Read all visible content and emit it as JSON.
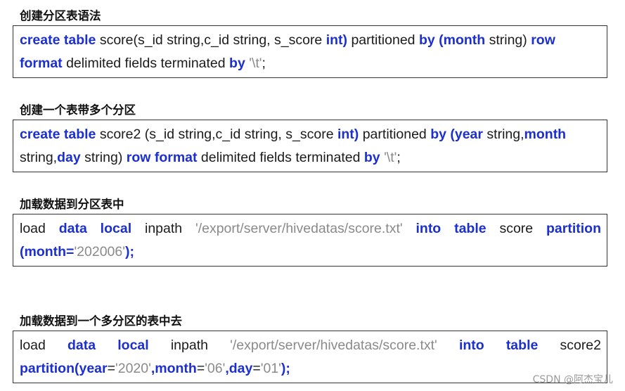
{
  "sections": [
    {
      "heading": "创建分区表语法",
      "lines": [
        [
          {
            "t": "create table",
            "k": "kw"
          },
          {
            "t": " score(s_id string,c_id string, s_score ",
            "k": "p"
          },
          {
            "t": "int)",
            "k": "kw"
          },
          {
            "t": " partitioned ",
            "k": "p"
          },
          {
            "t": "by (month",
            "k": "kw"
          },
          {
            "t": " string) ",
            "k": "p"
          },
          {
            "t": "row",
            "k": "kw"
          }
        ],
        [
          {
            "t": "format",
            "k": "kw"
          },
          {
            "t": " delimited fields terminated ",
            "k": "p"
          },
          {
            "t": "by",
            "k": "kw"
          },
          {
            "t": " ",
            "k": "p"
          },
          {
            "t": "'\\t'",
            "k": "str"
          },
          {
            "t": ";",
            "k": "p"
          }
        ]
      ]
    },
    {
      "heading": "创建一个表带多个分区",
      "lines": [
        [
          {
            "t": "create table",
            "k": "kw"
          },
          {
            "t": " score2 (s_id string,c_id string, s_score ",
            "k": "p"
          },
          {
            "t": "int)",
            "k": "kw"
          },
          {
            "t": " partitioned ",
            "k": "p"
          },
          {
            "t": "by (year",
            "k": "kw"
          },
          {
            "t": " string,",
            "k": "p"
          },
          {
            "t": "month",
            "k": "kw"
          }
        ],
        [
          {
            "t": "string,",
            "k": "p"
          },
          {
            "t": "day",
            "k": "kw"
          },
          {
            "t": " string) ",
            "k": "p"
          },
          {
            "t": "row format",
            "k": "kw"
          },
          {
            "t": " delimited fields terminated ",
            "k": "p"
          },
          {
            "t": "by",
            "k": "kw"
          },
          {
            "t": " ",
            "k": "p"
          },
          {
            "t": "'\\t'",
            "k": "str"
          },
          {
            "t": ";",
            "k": "p"
          }
        ]
      ]
    },
    {
      "heading": "加载数据到分区表中",
      "lines": [
        [
          {
            "t": "load ",
            "k": "p"
          },
          {
            "t": "data local",
            "k": "kw"
          },
          {
            "t": " inpath ",
            "k": "p"
          },
          {
            "t": "'/export/server/hivedatas/score.txt'",
            "k": "str"
          },
          {
            "t": " ",
            "k": "p"
          },
          {
            "t": "into table",
            "k": "kw"
          },
          {
            "t": " score ",
            "k": "p"
          },
          {
            "t": "partition",
            "k": "kw"
          }
        ],
        [
          {
            "t": "(month=",
            "k": "kw"
          },
          {
            "t": "'202006'",
            "k": "str"
          },
          {
            "t": ");",
            "k": "kw"
          }
        ]
      ]
    },
    {
      "heading": "加载数据到一个多分区的表中去",
      "lines": [
        [
          {
            "t": "load ",
            "k": "p"
          },
          {
            "t": "data local",
            "k": "kw"
          },
          {
            "t": " inpath ",
            "k": "p"
          },
          {
            "t": "'/export/server/hivedatas/score.txt'",
            "k": "str"
          },
          {
            "t": " ",
            "k": "p"
          },
          {
            "t": "into table",
            "k": "kw"
          },
          {
            "t": " score2",
            "k": "p"
          }
        ],
        [
          {
            "t": "partition(year",
            "k": "kw"
          },
          {
            "t": "=",
            "k": "p"
          },
          {
            "t": "'2020'",
            "k": "str"
          },
          {
            "t": ",month",
            "k": "kw"
          },
          {
            "t": "=",
            "k": "p"
          },
          {
            "t": "'06'",
            "k": "str"
          },
          {
            "t": ",day",
            "k": "kw"
          },
          {
            "t": "=",
            "k": "p"
          },
          {
            "t": "'01'",
            "k": "str"
          },
          {
            "t": ");",
            "k": "kw"
          }
        ]
      ]
    }
  ],
  "watermark": "CSDN @阿杰宝儿",
  "colors": {
    "keyword": "#1c2fcf",
    "string": "#8a8a8a",
    "text": "#1b1b1b",
    "border": "#333333"
  }
}
